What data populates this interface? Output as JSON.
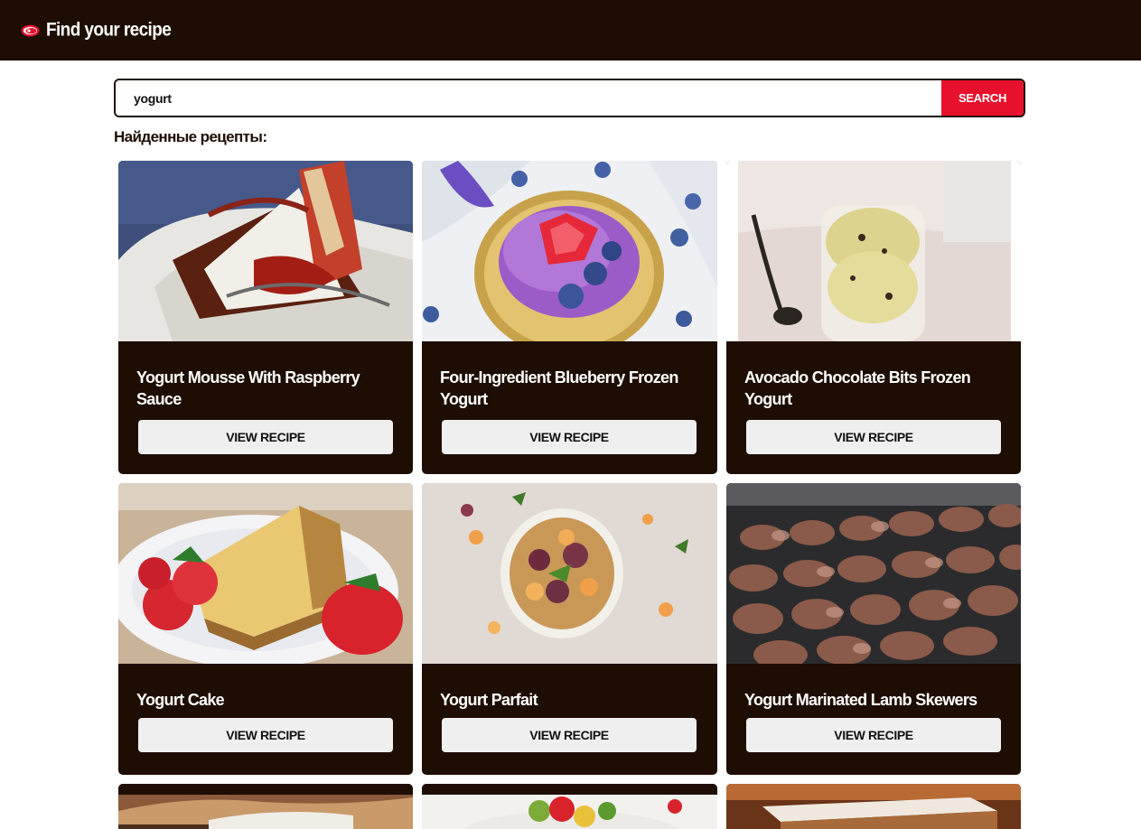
{
  "header": {
    "brand": "Find your recipe",
    "logo_icon": "meat-icon"
  },
  "search": {
    "value": "yogurt",
    "button_label": "SEARCH"
  },
  "results": {
    "title": "Найденные рецепты:",
    "button_label": "VIEW RECIPE",
    "cards": [
      {
        "title": "Yogurt Mousse With Raspberry Sauce",
        "image": "cheesecake-photo"
      },
      {
        "title": "Four-Ingredient Blueberry Frozen Yogurt",
        "image": "blueberry-yogurt-photo"
      },
      {
        "title": "Avocado Chocolate Bits Frozen Yogurt",
        "image": "avocado-frozen-yogurt-photo"
      },
      {
        "title": "Yogurt Cake",
        "image": "yogurt-cake-photo"
      },
      {
        "title": "Yogurt Parfait",
        "image": "parfait-photo"
      },
      {
        "title": "Yogurt Marinated Lamb Skewers",
        "image": "lamb-skewers-photo"
      },
      {
        "title": "",
        "image": "sandwich-photo"
      },
      {
        "title": "",
        "image": "fruit-salad-photo"
      },
      {
        "title": "",
        "image": "dessert-bar-photo"
      }
    ]
  },
  "colors": {
    "header_bg": "#1e0d02",
    "accent": "#e8112d",
    "button_bg": "#efefef"
  }
}
